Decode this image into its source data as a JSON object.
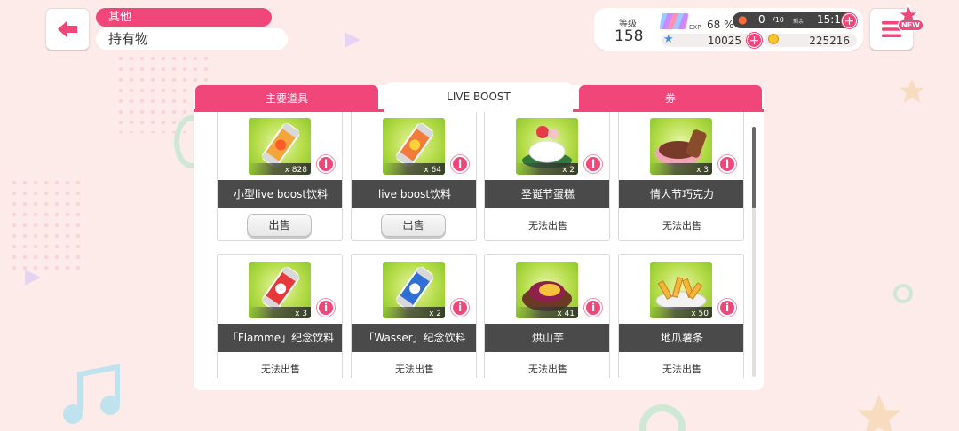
{
  "header": {
    "category": "其他",
    "title": "持有物"
  },
  "status": {
    "level_label": "等级",
    "level": "158",
    "exp_label": "EXP",
    "exp_percent": "68 %",
    "lp_value": "0",
    "lp_max": "/10",
    "lp_remaining_label": "剩余",
    "lp_time": "15:16",
    "stars": "10025",
    "coins": "225216"
  },
  "menu": {
    "new_badge": "NEW"
  },
  "tabs": [
    {
      "label": "主要道具",
      "active": false
    },
    {
      "label": "LIVE BOOST",
      "active": true
    },
    {
      "label": "券",
      "active": false
    }
  ],
  "items": [
    {
      "name": "小型live boost饮料",
      "qty": "x 828",
      "sell": "出售",
      "sellable": true,
      "icon": "small-boost-drink-icon"
    },
    {
      "name": "live boost饮料",
      "qty": "x 64",
      "sell": "出售",
      "sellable": true,
      "icon": "boost-drink-icon"
    },
    {
      "name": "圣诞节蛋糕",
      "qty": "x 2",
      "sell": "无法出售",
      "sellable": false,
      "icon": "christmas-cake-icon"
    },
    {
      "name": "情人节巧克力",
      "qty": "x 3",
      "sell": "无法出售",
      "sellable": false,
      "icon": "valentine-chocolate-icon"
    },
    {
      "name": "「Flamme」纪念饮料",
      "qty": "x 3",
      "sell": "无法出售",
      "sellable": false,
      "icon": "flamme-drink-icon"
    },
    {
      "name": "「Wasser」纪念饮料",
      "qty": "x 2",
      "sell": "无法出售",
      "sellable": false,
      "icon": "wasser-drink-icon"
    },
    {
      "name": "烘山芋",
      "qty": "x 41",
      "sell": "无法出售",
      "sellable": false,
      "icon": "baked-sweet-potato-icon"
    },
    {
      "name": "地瓜薯条",
      "qty": "x 50",
      "sell": "无法出售",
      "sellable": false,
      "icon": "sweet-potato-fries-icon"
    }
  ],
  "info_glyph": "i",
  "colors": {
    "accent": "#f0467a",
    "background": "#fcebe8",
    "item_bg": "#b4dc48",
    "name_bar": "#4a4a4a"
  }
}
